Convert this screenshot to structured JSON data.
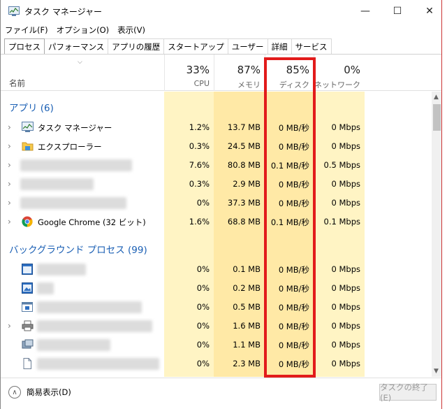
{
  "window": {
    "title": "タスク マネージャー",
    "controls": {
      "minimize": "—",
      "maximize": "☐",
      "close": "✕"
    }
  },
  "menu": [
    "ファイル(F)",
    "オプション(O)",
    "表示(V)"
  ],
  "tabs": [
    {
      "label": "プロセス",
      "active": true
    },
    {
      "label": "パフォーマンス",
      "active": false
    },
    {
      "label": "アプリの履歴",
      "active": false
    },
    {
      "label": "スタートアップ",
      "active": false
    },
    {
      "label": "ユーザー",
      "active": false
    },
    {
      "label": "詳細",
      "active": false
    },
    {
      "label": "サービス",
      "active": false
    }
  ],
  "header": {
    "name_label": "名前",
    "columns": [
      {
        "pct": "33%",
        "label": "CPU"
      },
      {
        "pct": "87%",
        "label": "メモリ"
      },
      {
        "pct": "85%",
        "label": "ディスク"
      },
      {
        "pct": "0%",
        "label": "ネットワーク"
      }
    ]
  },
  "groups": {
    "apps": "アプリ (6)",
    "background": "バックグラウンド プロセス (99)"
  },
  "app_rows": [
    {
      "name": "タスク マネージャー",
      "icon": "task-manager-icon",
      "cpu": "1.2%",
      "mem": "13.7 MB",
      "disk": "0 MB/秒",
      "net": "0 Mbps"
    },
    {
      "name": "エクスプローラー",
      "icon": "folder-icon",
      "cpu": "0.3%",
      "mem": "24.5 MB",
      "disk": "0 MB/秒",
      "net": "0 Mbps"
    },
    {
      "name": "",
      "icon": "blurred-icon",
      "cpu": "7.6%",
      "mem": "80.8 MB",
      "disk": "0.1 MB/秒",
      "net": "0.5 Mbps"
    },
    {
      "name": "",
      "icon": "blurred-icon",
      "cpu": "0.3%",
      "mem": "2.9 MB",
      "disk": "0 MB/秒",
      "net": "0 Mbps"
    },
    {
      "name": "",
      "icon": "blurred-icon",
      "cpu": "0%",
      "mem": "37.3 MB",
      "disk": "0 MB/秒",
      "net": "0 Mbps"
    },
    {
      "name": "Google Chrome (32 ビット)",
      "icon": "chrome-icon",
      "cpu": "1.6%",
      "mem": "68.8 MB",
      "disk": "0.1 MB/秒",
      "net": "0.1 Mbps"
    }
  ],
  "bg_rows": [
    {
      "cpu": "0%",
      "mem": "0.1 MB",
      "disk": "0 MB/秒",
      "net": "0 Mbps"
    },
    {
      "cpu": "0%",
      "mem": "0.2 MB",
      "disk": "0 MB/秒",
      "net": "0 Mbps"
    },
    {
      "cpu": "0%",
      "mem": "0.5 MB",
      "disk": "0 MB/秒",
      "net": "0 Mbps"
    },
    {
      "cpu": "0%",
      "mem": "1.6 MB",
      "disk": "0 MB/秒",
      "net": "0 Mbps"
    },
    {
      "cpu": "0%",
      "mem": "1.1 MB",
      "disk": "0 MB/秒",
      "net": "0 Mbps"
    },
    {
      "cpu": "0%",
      "mem": "2.3 MB",
      "disk": "0 MB/秒",
      "net": "0 Mbps"
    }
  ],
  "footer": {
    "fewer_details": "簡易表示(D)",
    "end_task": "タスクの終了(E)"
  },
  "colors": {
    "heat_light": "#fff4c4",
    "heat_mid": "#ffe9a6",
    "group_blue": "#1a5fb4",
    "highlight_red": "#e21b1b"
  }
}
